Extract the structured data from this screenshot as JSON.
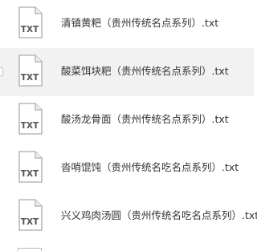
{
  "file_list": {
    "items": [
      {
        "name": "清镇黄粑（贵州传统名点系列）.txt",
        "icon_label": "TXT",
        "icon": "txt-file-icon"
      },
      {
        "name": "酸菜饵块粑（贵州传统名点系列）.txt",
        "icon_label": "TXT",
        "icon": "txt-file-icon"
      },
      {
        "name": "酸汤龙骨面（贵州传统名点系列）.txt",
        "icon_label": "TXT",
        "icon": "txt-file-icon"
      },
      {
        "name": "沓哨馄饨（贵州传统名吃名点系列）.txt",
        "icon_label": "TXT",
        "icon": "txt-file-icon"
      },
      {
        "name": "兴义鸡肉汤圆（贵州传统名吃名点系列）.txt",
        "icon_label": "TXT",
        "icon": "txt-file-icon"
      }
    ]
  },
  "colors": {
    "highlight_row": "#f2f2f2",
    "icon_outline": "#b9b9b9",
    "text": "#333333",
    "icon_text": "#555555"
  }
}
